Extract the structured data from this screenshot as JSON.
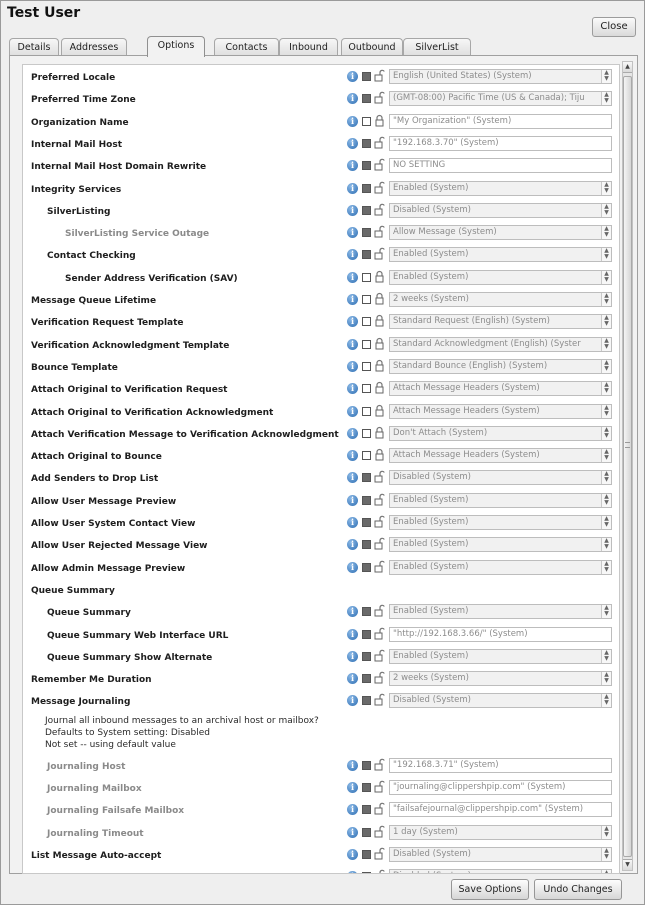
{
  "window": {
    "title": "Test User",
    "close_label": "Close"
  },
  "tabs": [
    "Details",
    "Addresses",
    "Options",
    "Contacts",
    "Inbound",
    "Outbound",
    "SilverList"
  ],
  "active_tab": "Options",
  "rows": [
    {
      "label": "Preferred Locale",
      "indent": 1,
      "value": "English (United States) (System)",
      "type": "select",
      "checked": true
    },
    {
      "label": "Preferred Time Zone",
      "indent": 1,
      "value": "(GMT-08:00) Pacific Time (US & Canada); Tiju",
      "type": "select",
      "checked": true
    },
    {
      "label": "Organization Name",
      "indent": 1,
      "value": "\"My Organization\" (System)",
      "type": "text",
      "checked": false
    },
    {
      "label": "Internal Mail Host",
      "indent": 1,
      "value": "\"192.168.3.70\" (System)",
      "type": "text",
      "checked": true
    },
    {
      "label": "Internal Mail Host Domain Rewrite",
      "indent": 1,
      "value": "NO SETTING",
      "type": "text",
      "checked": true
    },
    {
      "label": "Integrity Services",
      "indent": 1,
      "value": "Enabled (System)",
      "type": "select",
      "checked": true
    },
    {
      "label": "SilverListing",
      "indent": 2,
      "value": "Disabled (System)",
      "type": "select",
      "checked": true
    },
    {
      "label": "SilverListing Service Outage",
      "indent": 3,
      "value": "Allow Message (System)",
      "type": "select",
      "checked": true,
      "grey": true
    },
    {
      "label": "Contact Checking",
      "indent": 2,
      "value": "Enabled (System)",
      "type": "select",
      "checked": true
    },
    {
      "label": "Sender Address Verification (SAV)",
      "indent": 3,
      "value": "Enabled (System)",
      "type": "select",
      "checked": false
    },
    {
      "label": "Message Queue Lifetime",
      "indent": 1,
      "value": "2 weeks (System)",
      "type": "select",
      "checked": false
    },
    {
      "label": "Verification Request Template",
      "indent": 1,
      "value": "Standard Request (English) (System)",
      "type": "select",
      "checked": false
    },
    {
      "label": "Verification Acknowledgment Template",
      "indent": 1,
      "value": "Standard Acknowledgment (English) (Syster",
      "type": "select",
      "checked": false
    },
    {
      "label": "Bounce Template",
      "indent": 1,
      "value": "Standard Bounce (English) (System)",
      "type": "select",
      "checked": false
    },
    {
      "label": "Attach Original to Verification Request",
      "indent": 1,
      "value": "Attach Message Headers (System)",
      "type": "select",
      "checked": false
    },
    {
      "label": "Attach Original to Verification Acknowledgment",
      "indent": 1,
      "value": "Attach Message Headers (System)",
      "type": "select",
      "checked": false
    },
    {
      "label": "Attach Verification Message to Verification Acknowledgment",
      "indent": 1,
      "value": "Don't Attach (System)",
      "type": "select",
      "checked": false
    },
    {
      "label": "Attach Original to Bounce",
      "indent": 1,
      "value": "Attach Message Headers (System)",
      "type": "select",
      "checked": false
    },
    {
      "label": "Add Senders to Drop List",
      "indent": 1,
      "value": "Disabled (System)",
      "type": "select",
      "checked": true
    },
    {
      "label": "Allow User Message Preview",
      "indent": 1,
      "value": "Enabled (System)",
      "type": "select",
      "checked": true
    },
    {
      "label": "Allow User System Contact View",
      "indent": 1,
      "value": "Enabled (System)",
      "type": "select",
      "checked": true
    },
    {
      "label": "Allow User Rejected Message View",
      "indent": 1,
      "value": "Enabled (System)",
      "type": "select",
      "checked": true
    },
    {
      "label": "Allow Admin Message Preview",
      "indent": 1,
      "value": "Enabled (System)",
      "type": "select",
      "checked": true
    },
    {
      "label": "Queue Summary",
      "indent": 1,
      "header": true
    },
    {
      "label": "Queue Summary",
      "indent": 2,
      "value": "Enabled (System)",
      "type": "select",
      "checked": true
    },
    {
      "label": "Queue Summary Web Interface URL",
      "indent": 2,
      "value": "\"http://192.168.3.66/\" (System)",
      "type": "text",
      "checked": true
    },
    {
      "label": "Queue Summary Show Alternate",
      "indent": 2,
      "value": "Enabled (System)",
      "type": "select",
      "checked": true
    },
    {
      "label": "Remember Me Duration",
      "indent": 1,
      "value": "2 weeks (System)",
      "type": "select",
      "checked": true
    },
    {
      "label": "Message Journaling",
      "indent": 1,
      "value": "Disabled (System)",
      "type": "select",
      "checked": true
    }
  ],
  "journaling_desc": [
    "Journal all inbound messages to an archival host or mailbox?",
    "Defaults to System setting: Disabled",
    "Not set -- using default value"
  ],
  "journaling_rows": [
    {
      "label": "Journaling Host",
      "value": "\"192.168.3.71\" (System)",
      "type": "text",
      "checked": true,
      "grey": true
    },
    {
      "label": "Journaling Mailbox",
      "value": "\"journaling@clippershpip.com\" (System)",
      "type": "text",
      "checked": true,
      "grey": true
    },
    {
      "label": "Journaling Failsafe Mailbox",
      "value": "\"failsafejournal@clippershpip.com\" (System)",
      "type": "text",
      "checked": true,
      "grey": true
    },
    {
      "label": "Journaling Timeout",
      "value": "1 day (System)",
      "type": "select",
      "checked": true,
      "grey": true
    }
  ],
  "tail_rows": [
    {
      "label": "List Message Auto-accept",
      "indent": 1,
      "value": "Disabled (System)",
      "type": "select",
      "checked": true
    },
    {
      "label": "Add Contact on Auto-accept",
      "indent": 2,
      "value": "Disabled (System)",
      "type": "select",
      "checked": true,
      "grey": true
    }
  ],
  "buttons": {
    "save": "Save Options",
    "undo": "Undo Changes"
  },
  "icons": [
    "info-icon",
    "lock-icon",
    "unlock-icon"
  ]
}
